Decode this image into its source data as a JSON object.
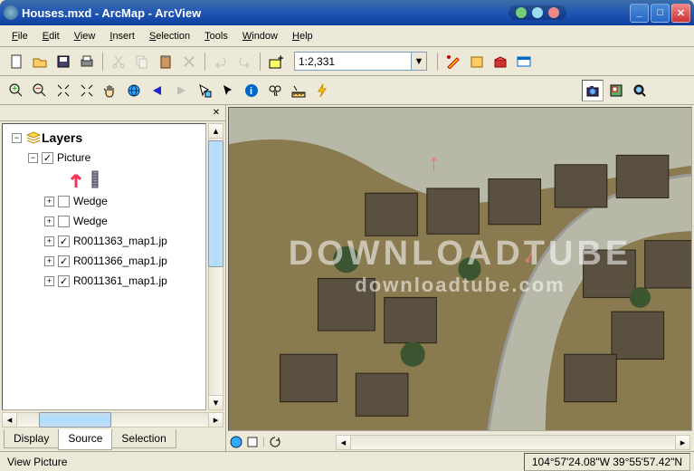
{
  "title": "Houses.mxd - ArcMap - ArcView",
  "menu": [
    "File",
    "Edit",
    "View",
    "Insert",
    "Selection",
    "Tools",
    "Window",
    "Help"
  ],
  "scale": "1:2,331",
  "toc": {
    "root": "Layers",
    "items": [
      {
        "pm": "−",
        "checked": true,
        "label": "Picture",
        "indent": 2,
        "editable": false
      },
      {
        "pm": "+",
        "checked": false,
        "label": "Wedge",
        "indent": 3
      },
      {
        "pm": "+",
        "checked": false,
        "label": "Wedge",
        "indent": 3
      },
      {
        "pm": "+",
        "checked": true,
        "label": "R0011363_map1.jp",
        "indent": 3
      },
      {
        "pm": "+",
        "checked": true,
        "label": "R0011366_map1.jp",
        "indent": 3
      },
      {
        "pm": "+",
        "checked": true,
        "label": "R0011361_map1.jp",
        "indent": 3
      }
    ],
    "tabs": [
      "Display",
      "Source",
      "Selection"
    ],
    "active_tab": "Source"
  },
  "status": {
    "left": "View Picture",
    "coords": "104°57'24.08\"W 39°55'57.42\"N"
  },
  "toolbar1": [
    "new",
    "open",
    "save",
    "print",
    "|",
    "cut",
    "copy",
    "paste",
    "delete",
    "|",
    "undo",
    "redo",
    "|",
    "add-data"
  ],
  "toolbar1_right": [
    "editor",
    "arccatalog",
    "arctoolbox",
    "command"
  ],
  "toolbar2": [
    "zoom-in",
    "zoom-out",
    "fixed-zoom-in",
    "fixed-zoom-out",
    "pan",
    "full-extent",
    "prev",
    "next",
    "select-elements",
    "pointer",
    "identify",
    "find",
    "measure",
    "flash"
  ],
  "toolbar2_right": [
    "camera",
    "overview",
    "magnifier"
  ],
  "colors": {
    "accent": "#2156b5",
    "red": "#ff5060"
  }
}
